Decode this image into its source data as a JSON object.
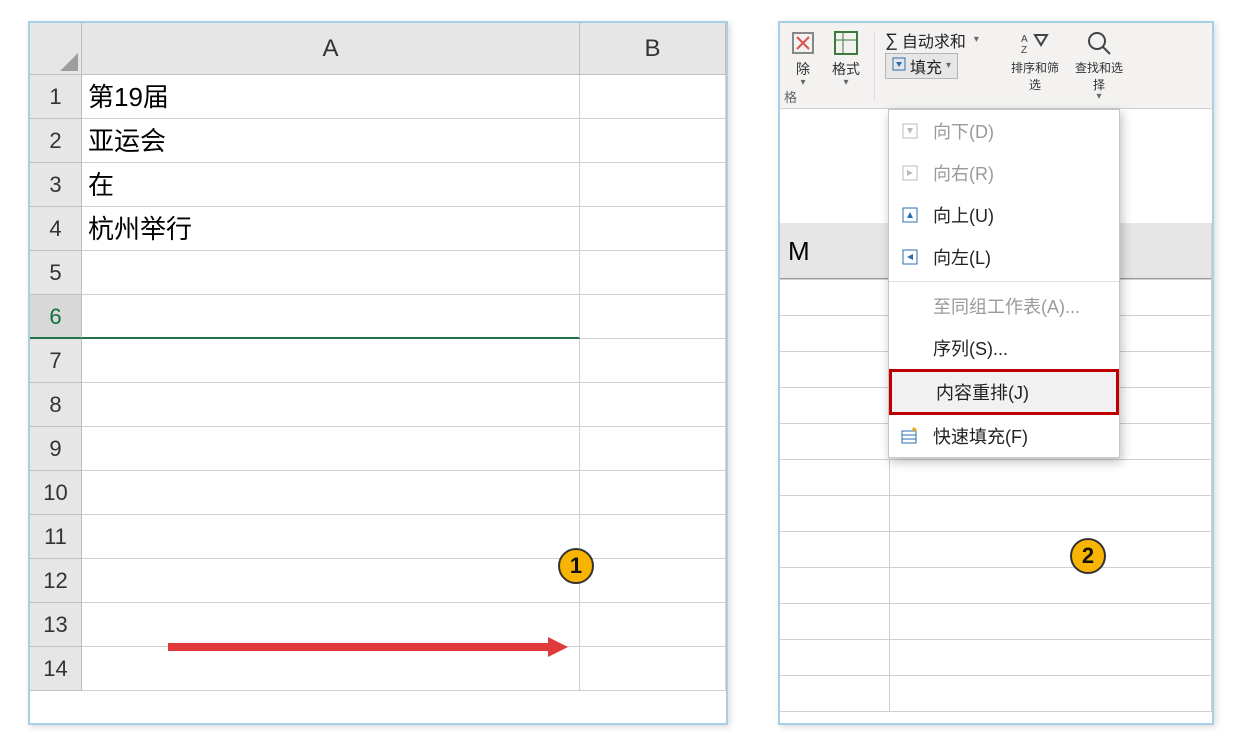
{
  "spreadsheet": {
    "columns": [
      "A",
      "B"
    ],
    "rows": [
      {
        "num": "1",
        "A": "第19届"
      },
      {
        "num": "2",
        "A": "亚运会"
      },
      {
        "num": "3",
        "A": "在"
      },
      {
        "num": "4",
        "A": "杭州举行"
      },
      {
        "num": "5",
        "A": ""
      },
      {
        "num": "6",
        "A": "",
        "selected": true
      },
      {
        "num": "7",
        "A": ""
      },
      {
        "num": "8",
        "A": ""
      },
      {
        "num": "9",
        "A": ""
      },
      {
        "num": "10",
        "A": ""
      },
      {
        "num": "11",
        "A": ""
      },
      {
        "num": "12",
        "A": ""
      },
      {
        "num": "13",
        "A": ""
      },
      {
        "num": "14",
        "A": ""
      }
    ]
  },
  "badges": {
    "b1": "1",
    "b2": "2"
  },
  "ribbon": {
    "delete_label": "除",
    "format_label": "格式",
    "group_cells": "格",
    "autosum": "自动求和",
    "fill": "填充",
    "sort_filter": "排序和筛选",
    "find_select": "查找和选择"
  },
  "fill_menu": {
    "down": "向下(D)",
    "right": "向右(R)",
    "up": "向上(U)",
    "left": "向左(L)",
    "across": "至同组工作表(A)...",
    "series": "序列(S)...",
    "justify": "内容重排(J)",
    "flash": "快速填充(F)"
  },
  "right_sheet": {
    "col_M": "M"
  }
}
